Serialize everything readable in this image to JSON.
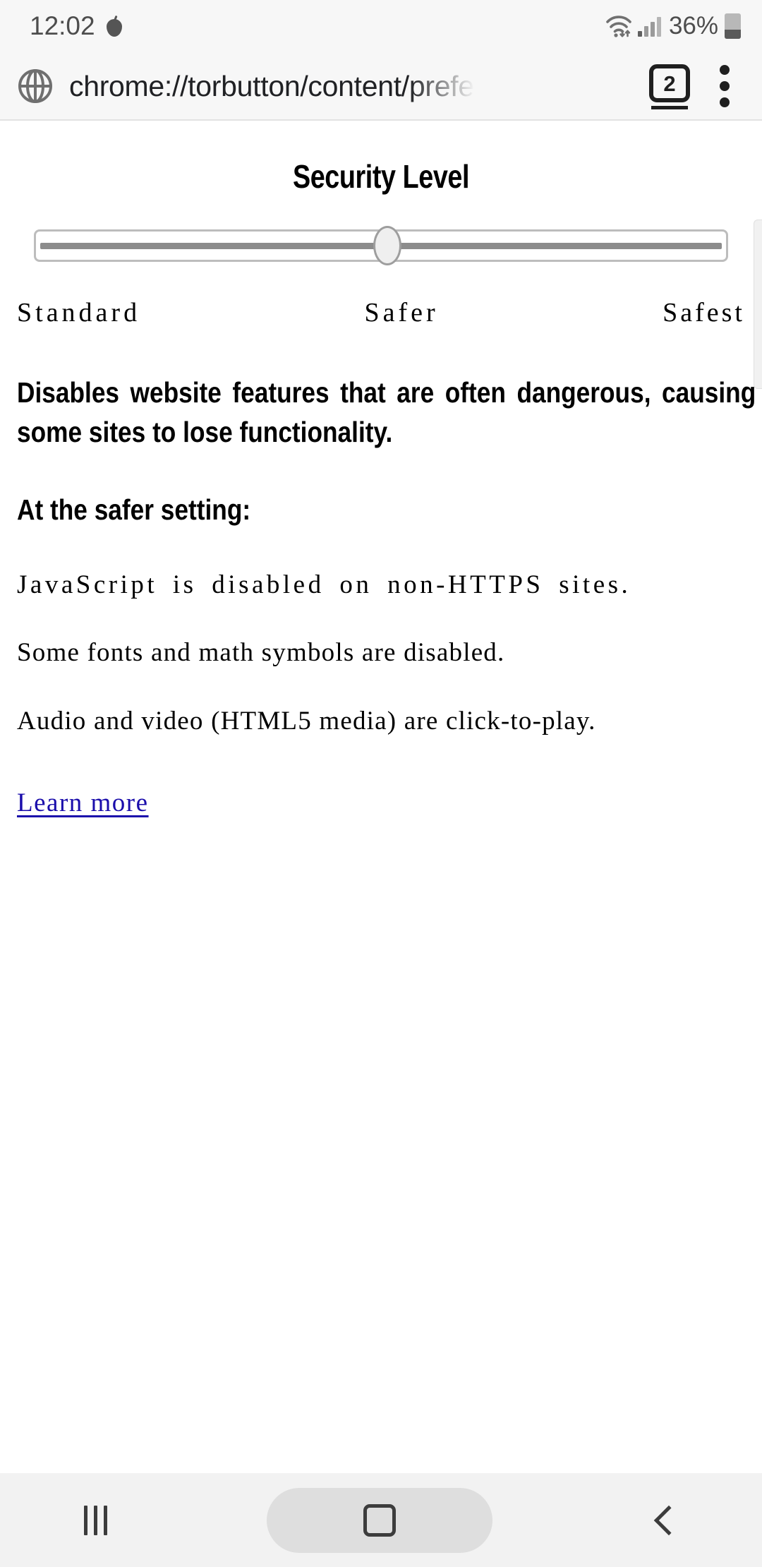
{
  "status_bar": {
    "time": "12:02",
    "battery_percent": "36%",
    "icons": {
      "bomb": "bomb-icon",
      "wifi": "wifi-icon",
      "signal": "signal-bars-icon",
      "battery": "battery-icon"
    }
  },
  "url_bar": {
    "site_icon": "globe-icon",
    "url": "chrome://torbutton/content/prefe",
    "tab_count": "2",
    "menu_icon": "overflow-menu-icon"
  },
  "page": {
    "title": "Security Level",
    "slider": {
      "value_index": 1,
      "labels": [
        "Standard",
        "Safer",
        "Safest"
      ]
    },
    "description": "Disables website features that are often dangerous, causing some sites to lose functionality.",
    "setting_heading": "At the safer setting:",
    "features": [
      "JavaScript is disabled on non-HTTPS sites.",
      "Some fonts and math symbols are disabled.",
      "Audio and video (HTML5 media) are click-to-play."
    ],
    "learn_more": "Learn more",
    "link_color": "#1a0dab"
  },
  "nav_bar": {
    "recents": "recents-icon",
    "home": "home-icon",
    "back": "back-icon"
  }
}
